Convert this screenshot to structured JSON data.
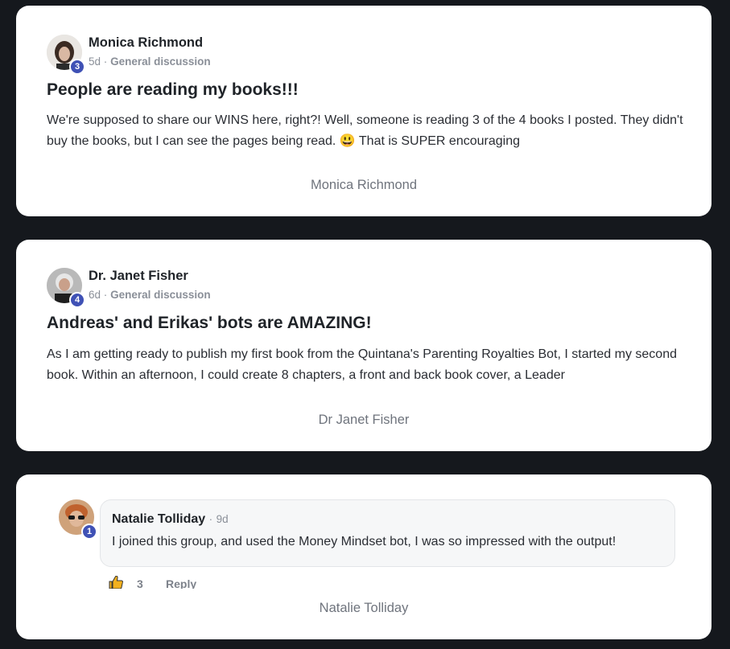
{
  "posts": [
    {
      "author": "Monica Richmond",
      "level": "3",
      "age": "5d",
      "category": "General discussion",
      "title": "People are reading my books!!!",
      "body": "We're supposed to share our WINS here, right?! Well, someone is reading 3 of the 4 books I posted. They didn't buy the books, but I can see the pages being read. 😃 That is SUPER encouraging",
      "footer": "Monica Richmond"
    },
    {
      "author": "Dr. Janet Fisher",
      "level": "4",
      "age": "6d",
      "category": "General discussion",
      "title": "Andreas' and Erikas' bots are AMAZING!",
      "body": "As I am getting ready to publish my first book from the Quintana's Parenting Royalties Bot, I started my second book. Within an afternoon, I could create 8 chapters, a front and back book cover, a Leader",
      "footer": "Dr Janet Fisher"
    }
  ],
  "comment": {
    "author": "Natalie Tolliday",
    "level": "1",
    "age": "9d",
    "text": "I joined this group, and used the Money Mindset bot, I was so impressed with the output!",
    "likes": "3",
    "reply_label": "Reply",
    "footer": "Natalie Tolliday"
  },
  "separator": "·",
  "colors": {
    "background": "#15181d",
    "card": "#ffffff",
    "level_badge": "#3f51b5",
    "meta_text": "#8a8f98"
  },
  "icons": {
    "like": "thumbs-up-icon"
  }
}
